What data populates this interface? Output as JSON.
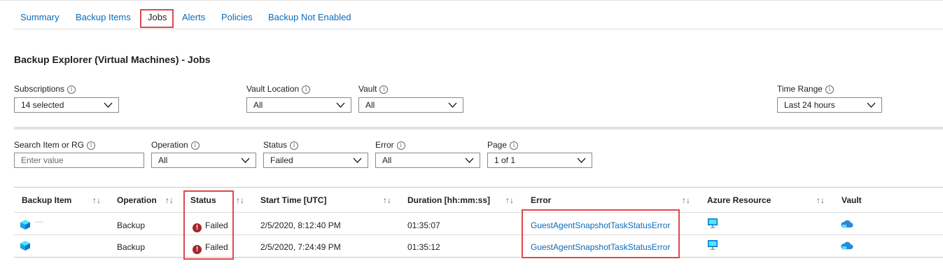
{
  "tabs": [
    {
      "label": "Summary"
    },
    {
      "label": "Backup Items"
    },
    {
      "label": "Jobs"
    },
    {
      "label": "Alerts"
    },
    {
      "label": "Policies"
    },
    {
      "label": "Backup Not Enabled"
    }
  ],
  "page_title": "Backup Explorer (Virtual Machines) - Jobs",
  "filters_top": {
    "subscriptions": {
      "label": "Subscriptions",
      "value": "14 selected"
    },
    "vault_location": {
      "label": "Vault Location",
      "value": "All"
    },
    "vault": {
      "label": "Vault",
      "value": "All"
    },
    "time_range": {
      "label": "Time Range",
      "value": "Last 24 hours"
    }
  },
  "filters_bottom": {
    "search": {
      "label": "Search Item or RG",
      "placeholder": "Enter value"
    },
    "operation": {
      "label": "Operation",
      "value": "All"
    },
    "status": {
      "label": "Status",
      "value": "Failed"
    },
    "error": {
      "label": "Error",
      "value": "All"
    },
    "page": {
      "label": "Page",
      "value": "1 of 1"
    }
  },
  "info_glyph": "i",
  "sort_glyph": "↑↓",
  "table": {
    "columns": [
      "Backup Item",
      "Operation",
      "Status",
      "Start Time [UTC]",
      "Duration [hh:mm:ss]",
      "Error",
      "Azure Resource",
      "Vault"
    ],
    "rows": [
      {
        "operation": "Backup",
        "status": "Failed",
        "start_time": "2/5/2020, 8:12:40 PM",
        "duration": "01:35:07",
        "error": "GuestAgentSnapshotTaskStatusError"
      },
      {
        "operation": "Backup",
        "status": "Failed",
        "start_time": "2/5/2020, 7:24:49 PM",
        "duration": "01:35:12",
        "error": "GuestAgentSnapshotTaskStatusError"
      }
    ]
  },
  "colors": {
    "link": "#0b6ab8",
    "highlight": "#e0474c",
    "failed": "#a4262c",
    "cube": "#1ba1e2",
    "cloud": "#2b88d8"
  },
  "icons": {
    "row_item": "vm-cube-icon",
    "status_failed": "error-circle-icon",
    "resource": "monitor-icon",
    "vault": "cloud-vault-icon",
    "dropdown": "chevron-down-icon",
    "info": "info-icon"
  }
}
